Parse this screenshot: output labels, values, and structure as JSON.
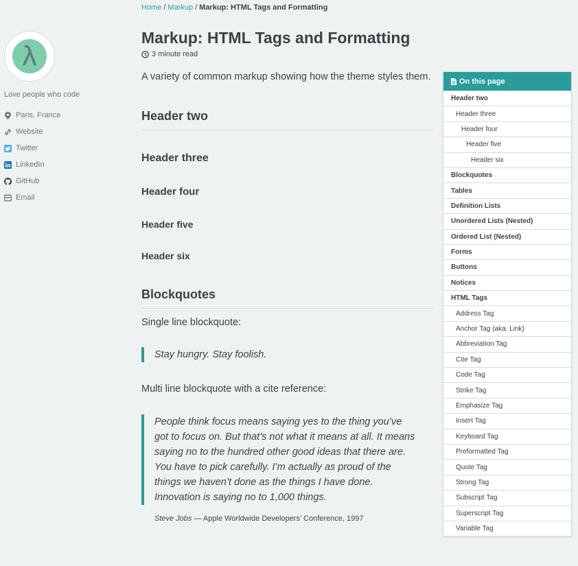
{
  "breadcrumb": {
    "home": "Home",
    "sep1": "/",
    "section": "Markup",
    "sep2": "/",
    "current": "Markup: HTML Tags and Formatting"
  },
  "author": {
    "avatar_letter": "λ",
    "bio": "Love people who code",
    "links": [
      {
        "icon": "map-marker-icon",
        "label": "Paris, France"
      },
      {
        "icon": "link-icon",
        "label": "Website"
      },
      {
        "icon": "twitter-icon",
        "label": "Twitter"
      },
      {
        "icon": "linkedin-icon",
        "label": "LinkedIn"
      },
      {
        "icon": "github-icon",
        "label": "GitHub"
      },
      {
        "icon": "envelope-icon",
        "label": "Email"
      }
    ]
  },
  "article": {
    "title": "Markup: HTML Tags and Formatting",
    "read_time": "3 minute read",
    "intro": "A variety of common markup showing how the theme styles them.",
    "h2": "Header two",
    "h3": "Header three",
    "h4": "Header four",
    "h5": "Header five",
    "h6": "Header six",
    "blockquotes_heading": "Blockquotes",
    "single_label": "Single line blockquote:",
    "single_quote": "Stay hungry. Stay foolish.",
    "multi_label": "Multi line blockquote with a cite reference:",
    "multi_quote": "People think focus means saying yes to the thing you’ve got to focus on. But that’s not what it means at all. It means saying no to the hundred other good ideas that there are. You have to pick carefully. I’m actually as proud of the things we haven’t done as the things I have done. Innovation is saying no to 1,000 things.",
    "cite_author": "Steve Jobs",
    "cite_source": " — Apple Worldwide Developers’ Conference, 1997"
  },
  "toc": {
    "title": "On this page",
    "items": [
      {
        "label": "Header two",
        "level": 2
      },
      {
        "label": "Header three",
        "level": 3
      },
      {
        "label": "Header four",
        "level": 4
      },
      {
        "label": "Header five",
        "level": 5
      },
      {
        "label": "Header six",
        "level": 6
      },
      {
        "label": "Blockquotes",
        "level": 2
      },
      {
        "label": "Tables",
        "level": 2
      },
      {
        "label": "Definition Lists",
        "level": 2
      },
      {
        "label": "Unordered Lists (Nested)",
        "level": 2
      },
      {
        "label": "Ordered List (Nested)",
        "level": 2
      },
      {
        "label": "Forms",
        "level": 2
      },
      {
        "label": "Buttons",
        "level": 2
      },
      {
        "label": "Notices",
        "level": 2
      },
      {
        "label": "HTML Tags",
        "level": 2
      },
      {
        "label": "Address Tag",
        "level": 3
      },
      {
        "label": "Anchor Tag (aka. Link)",
        "level": 3
      },
      {
        "label": "Abbreviation Tag",
        "level": 3
      },
      {
        "label": "Cite Tag",
        "level": 3
      },
      {
        "label": "Code Tag",
        "level": 3
      },
      {
        "label": "Strike Tag",
        "level": 3
      },
      {
        "label": "Emphasize Tag",
        "level": 3
      },
      {
        "label": "Insert Tag",
        "level": 3
      },
      {
        "label": "Keyboard Tag",
        "level": 3
      },
      {
        "label": "Preformatted Tag",
        "level": 3
      },
      {
        "label": "Quote Tag",
        "level": 3
      },
      {
        "label": "Strong Tag",
        "level": 3
      },
      {
        "label": "Subscript Tag",
        "level": 3
      },
      {
        "label": "Superscript Tag",
        "level": 3
      },
      {
        "label": "Variable Tag",
        "level": 3
      }
    ]
  },
  "colors": {
    "accent": "#2a9c9c",
    "background": "#eef3f2",
    "text": "#3d4144",
    "avatar_bg": "#7ecdab"
  }
}
